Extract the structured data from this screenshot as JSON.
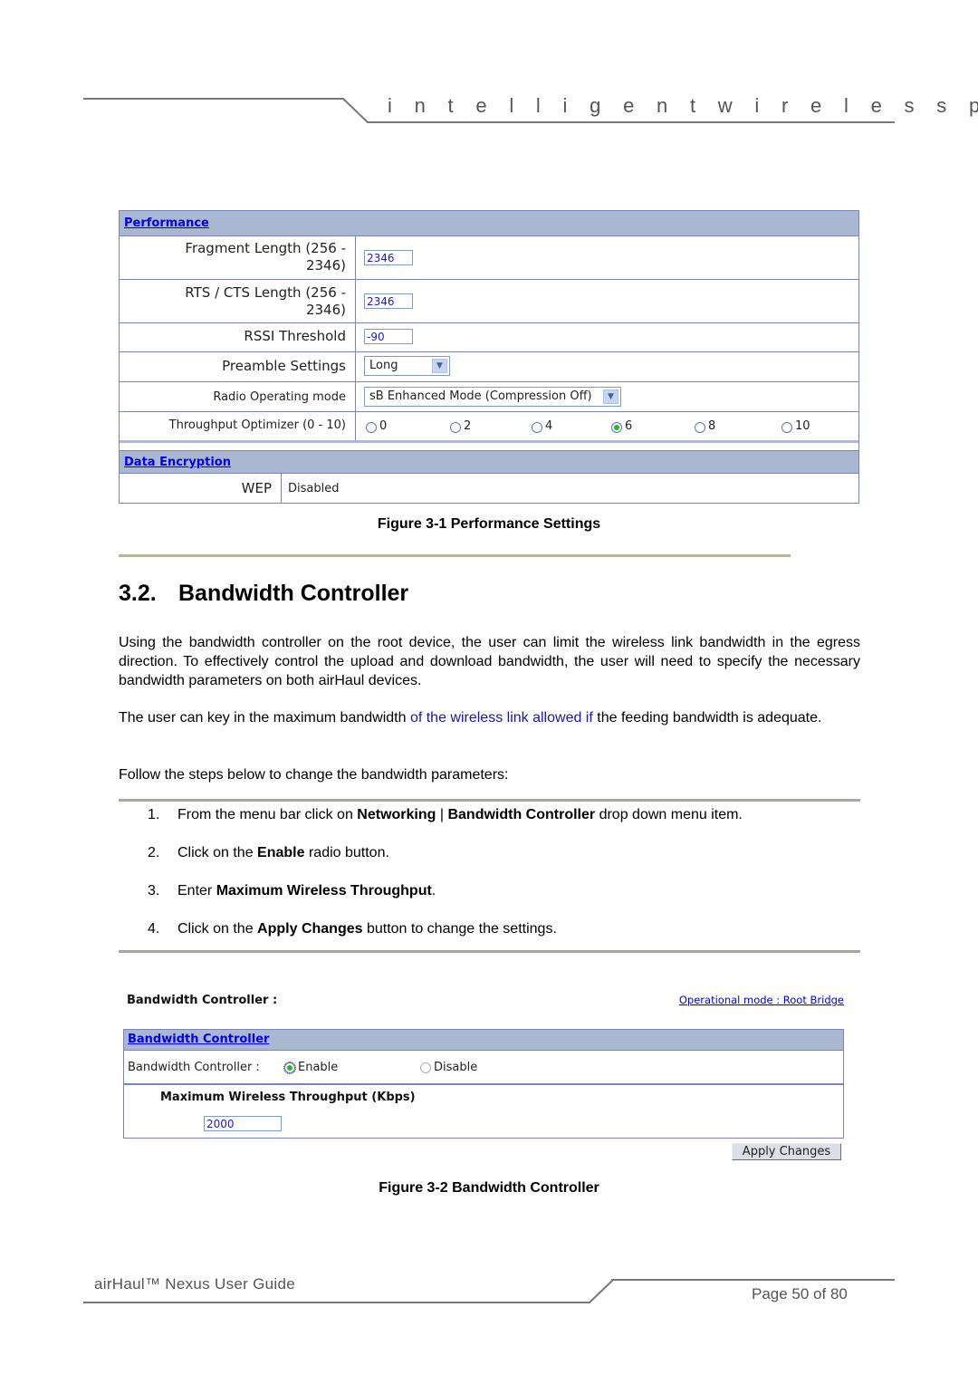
{
  "header": {
    "tagline": "i n t e l l i g e n t   w i r e l e s s   p l a t f o r m"
  },
  "figure1": {
    "section_performance": "Performance",
    "rows": [
      {
        "label_line1": "Fragment Length (256 -",
        "label_line2": "2346)",
        "value": "2346"
      },
      {
        "label_line1": "RTS / CTS Length (256 -",
        "label_line2": "2346)",
        "value": "2346"
      },
      {
        "label": "RSSI Threshold",
        "value": "-90"
      },
      {
        "label": "Preamble Settings",
        "selected": "Long"
      },
      {
        "label": "Radio Operating mode",
        "selected": "sB Enhanced Mode (Compression Off)"
      },
      {
        "label": "Throughput Optimizer (0 - 10)",
        "options": [
          "0",
          "2",
          "4",
          "6",
          "8",
          "10"
        ],
        "selected": "6"
      }
    ],
    "section_encryption": "Data Encryption",
    "wep_label": "WEP",
    "wep_value": "Disabled",
    "caption": "Figure 3-1 Performance Settings"
  },
  "section": {
    "number": "3.2.",
    "title": "Bandwidth Controller"
  },
  "paragraphs": {
    "p1": "Using the bandwidth controller on the root device, the user can limit the wireless link bandwidth in the egress direction. To effectively control the upload and download bandwidth, the user will need to specify the necessary bandwidth parameters on both airHaul devices.",
    "p2_a": "The user can key in the maximum bandwidth ",
    "p2_blue": "of the wireless link allowed if",
    "p2_b": " the feeding bandwidth is adequate.",
    "p3": "Follow the steps below to change the bandwidth parameters:"
  },
  "steps": [
    {
      "n": "1.",
      "t1": "From the menu bar click on ",
      "b1": "Networking",
      "t2": " | ",
      "b2": "Bandwidth Controller",
      "t3": " drop down menu item."
    },
    {
      "n": "2.",
      "t1": "Click on the ",
      "b1": "Enable",
      "t2": " radio button."
    },
    {
      "n": "3.",
      "t1": "Enter ",
      "b1": "Maximum Wireless Throughput",
      "t2": "."
    },
    {
      "n": "4.",
      "t1": "Click on the ",
      "b1": "Apply Changes",
      "t2": " button to change the settings."
    }
  ],
  "figure2": {
    "page_title": "Bandwidth Controller :",
    "mode_link": "Operational mode : Root Bridge",
    "section_head": "Bandwidth Controller",
    "bc_label": "Bandwidth Controller :",
    "enable_label": "Enable",
    "disable_label": "Disable",
    "enabled": true,
    "max_label": "Maximum Wireless Throughput (Kbps)",
    "max_value": "2000",
    "apply_label": "Apply Changes",
    "caption": "Figure 3-2 Bandwidth Controller"
  },
  "footer": {
    "doc_title": "airHaul™ Nexus User Guide",
    "page": "Page 50 of 80"
  }
}
